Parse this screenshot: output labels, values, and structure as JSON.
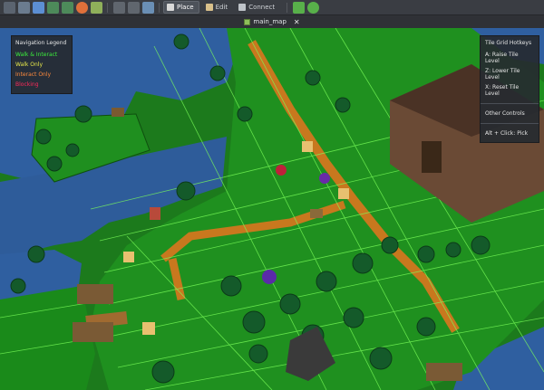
{
  "toolbar": {
    "icons": [
      "grid-icon",
      "save-icon",
      "copy-icon",
      "undo-icon",
      "redo-icon",
      "record-icon",
      "image-icon",
      "grid-toggle-icon",
      "fullscreen-icon",
      "camera-icon"
    ],
    "place_label": "Place",
    "edit_label": "Edit",
    "connect_label": "Connect",
    "right_icons": [
      "shuffle-icon",
      "refresh-icon"
    ]
  },
  "tabs": [
    {
      "label": "main_map",
      "close": "✕"
    }
  ],
  "legend": {
    "title": "Navigation Legend",
    "items": [
      {
        "label": "Walk & Interact",
        "color": "#3cf03c"
      },
      {
        "label": "Walk Only",
        "color": "#e8e84a"
      },
      {
        "label": "Interact Only",
        "color": "#ff8a3c"
      },
      {
        "label": "Blocking",
        "color": "#ff2a5a"
      }
    ]
  },
  "hotkeys": {
    "title": "Tile Grid Hotkeys",
    "items": [
      "A: Raise Tile Level",
      "Z: Lower Tile Level",
      "X: Reset Tile Level"
    ],
    "other_title": "Other Controls",
    "other_items": [
      "Alt + Click: Pick"
    ]
  },
  "colors": {
    "grass": "#1f8a1f",
    "water": "#2f5fa0",
    "path": "#c8781e",
    "grid": "#7cff5a"
  }
}
